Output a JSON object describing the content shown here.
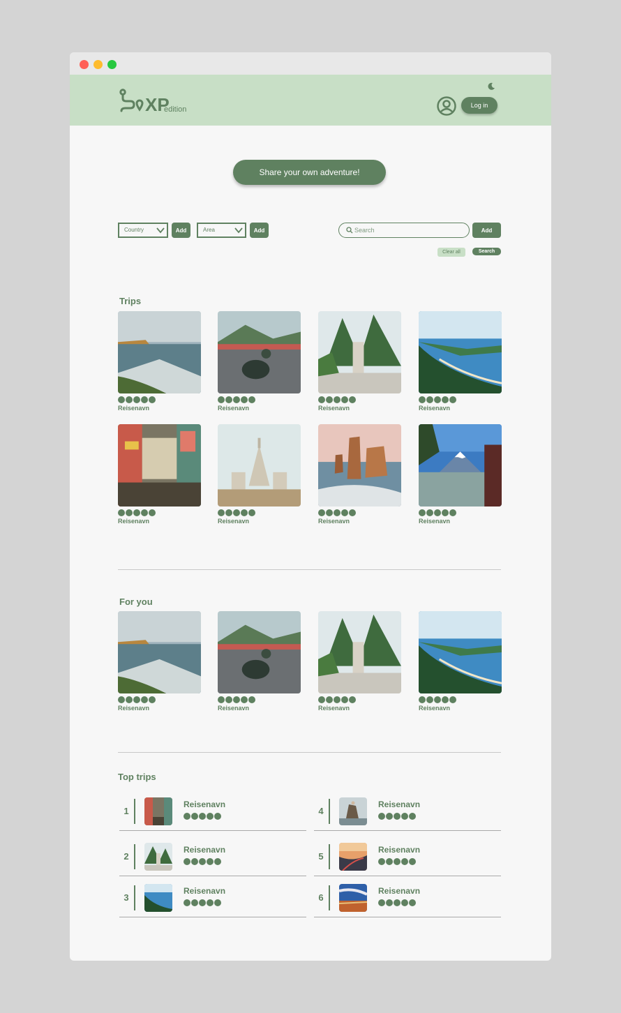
{
  "header": {
    "login_label": "Log in",
    "logo_text": "XP",
    "logo_sub": "edition"
  },
  "share_label": "Share your own adventure!",
  "filters": {
    "country_label": "Country",
    "area_label": "Area",
    "add_label": "Add",
    "search_placeholder": "Search",
    "clear_label": "Clear all",
    "search_label": "Search"
  },
  "trips": {
    "title": "Trips",
    "items": [
      {
        "name": "Reisenavn",
        "rating": 5,
        "scene": "coast-cliffs"
      },
      {
        "name": "Reisenavn",
        "rating": 5,
        "scene": "road-riders"
      },
      {
        "name": "Reisenavn",
        "rating": 5,
        "scene": "temple-mountain"
      },
      {
        "name": "Reisenavn",
        "rating": 5,
        "scene": "bay-aerial"
      },
      {
        "name": "Reisenavn",
        "rating": 5,
        "scene": "city-street"
      },
      {
        "name": "Reisenavn",
        "rating": 5,
        "scene": "temple-spire"
      },
      {
        "name": "Reisenavn",
        "rating": 5,
        "scene": "sea-stacks"
      },
      {
        "name": "Reisenavn",
        "rating": 5,
        "scene": "mount-fuji"
      }
    ]
  },
  "for_you": {
    "title": "For you",
    "items": [
      {
        "name": "Reisenavn",
        "rating": 5,
        "scene": "coast-cliffs"
      },
      {
        "name": "Reisenavn",
        "rating": 5,
        "scene": "road-riders"
      },
      {
        "name": "Reisenavn",
        "rating": 5,
        "scene": "temple-mountain"
      },
      {
        "name": "Reisenavn",
        "rating": 5,
        "scene": "bay-aerial"
      }
    ]
  },
  "top_trips": {
    "title": "Top trips",
    "items": [
      {
        "rank": "1",
        "name": "Reisenavn",
        "rating": 5
      },
      {
        "rank": "2",
        "name": "Reisenavn",
        "rating": 5
      },
      {
        "rank": "3",
        "name": "Reisenavn",
        "rating": 5
      },
      {
        "rank": "4",
        "name": "Reisenavn",
        "rating": 5
      },
      {
        "rank": "5",
        "name": "Reisenavn",
        "rating": 5
      },
      {
        "rank": "6",
        "name": "Reisenavn",
        "rating": 5
      }
    ]
  },
  "colors": {
    "brand_green": "#5f8160",
    "header_bg": "#c8dfc6",
    "page_bg": "#f7f7f7"
  }
}
